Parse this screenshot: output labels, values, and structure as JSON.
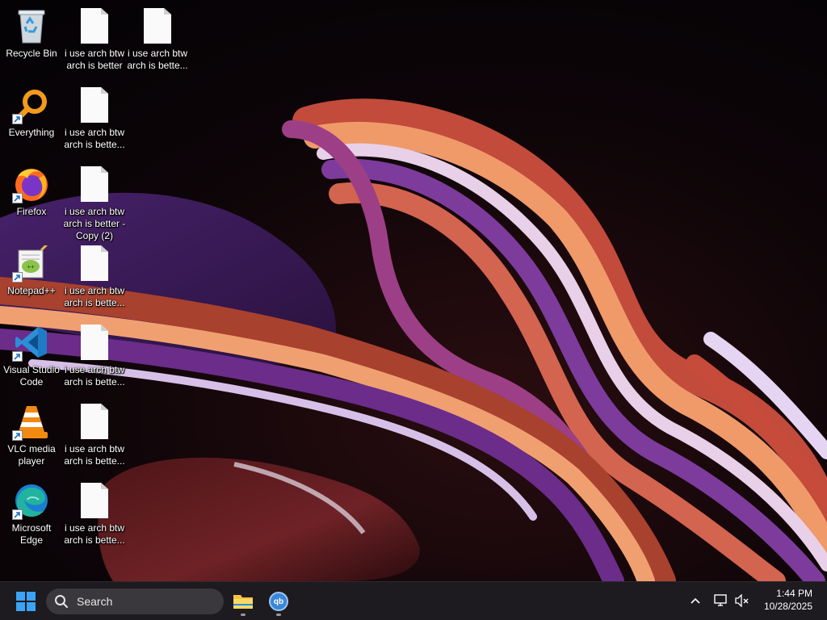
{
  "desktop": {
    "icons": [
      {
        "label": "Recycle Bin",
        "icon": "recycle-bin-icon"
      },
      {
        "label": "Everything",
        "icon": "everything-search-icon",
        "shortcut": true
      },
      {
        "label": "Firefox",
        "icon": "firefox-icon",
        "shortcut": true
      },
      {
        "label": "Notepad++",
        "icon": "notepad-plus-plus-icon",
        "shortcut": true
      },
      {
        "label": "Visual Studio Code",
        "icon": "vscode-icon",
        "shortcut": true
      },
      {
        "label": "VLC media player",
        "icon": "vlc-icon",
        "shortcut": true
      },
      {
        "label": "Microsoft Edge",
        "icon": "edge-icon",
        "shortcut": true
      },
      {
        "label": "i use arch btw arch is better",
        "icon": "text-file-icon"
      },
      {
        "label": "i use arch btw arch is bette...",
        "icon": "text-file-icon"
      },
      {
        "label": "i use arch btw arch is better - Copy (2)",
        "icon": "text-file-icon"
      },
      {
        "label": "i use arch btw arch is bette...",
        "icon": "text-file-icon"
      },
      {
        "label": "i use arch btw arch is bette...",
        "icon": "text-file-icon"
      },
      {
        "label": "i use arch btw arch is bette...",
        "icon": "text-file-icon"
      },
      {
        "label": "i use arch btw arch is bette...",
        "icon": "text-file-icon"
      },
      {
        "label": "i use arch btw arch is bette...",
        "icon": "text-file-icon"
      }
    ]
  },
  "taskbar": {
    "search_label": "Search",
    "pinned": [
      {
        "name": "file-explorer",
        "icon": "folder-icon"
      },
      {
        "name": "qbittorrent",
        "icon": "qbittorrent-icon",
        "text": "qb"
      }
    ],
    "clock_time": "1:44 PM",
    "clock_date": "10/28/2025"
  },
  "colors": {
    "taskbar_bg": "#1d1b1f",
    "windows_blue": "#3aa3f5",
    "firefox_orange": "#ff6a1f",
    "vscode_blue": "#2a8ed8",
    "vlc_orange": "#f28a12",
    "edge_teal": "#21b3a0"
  }
}
